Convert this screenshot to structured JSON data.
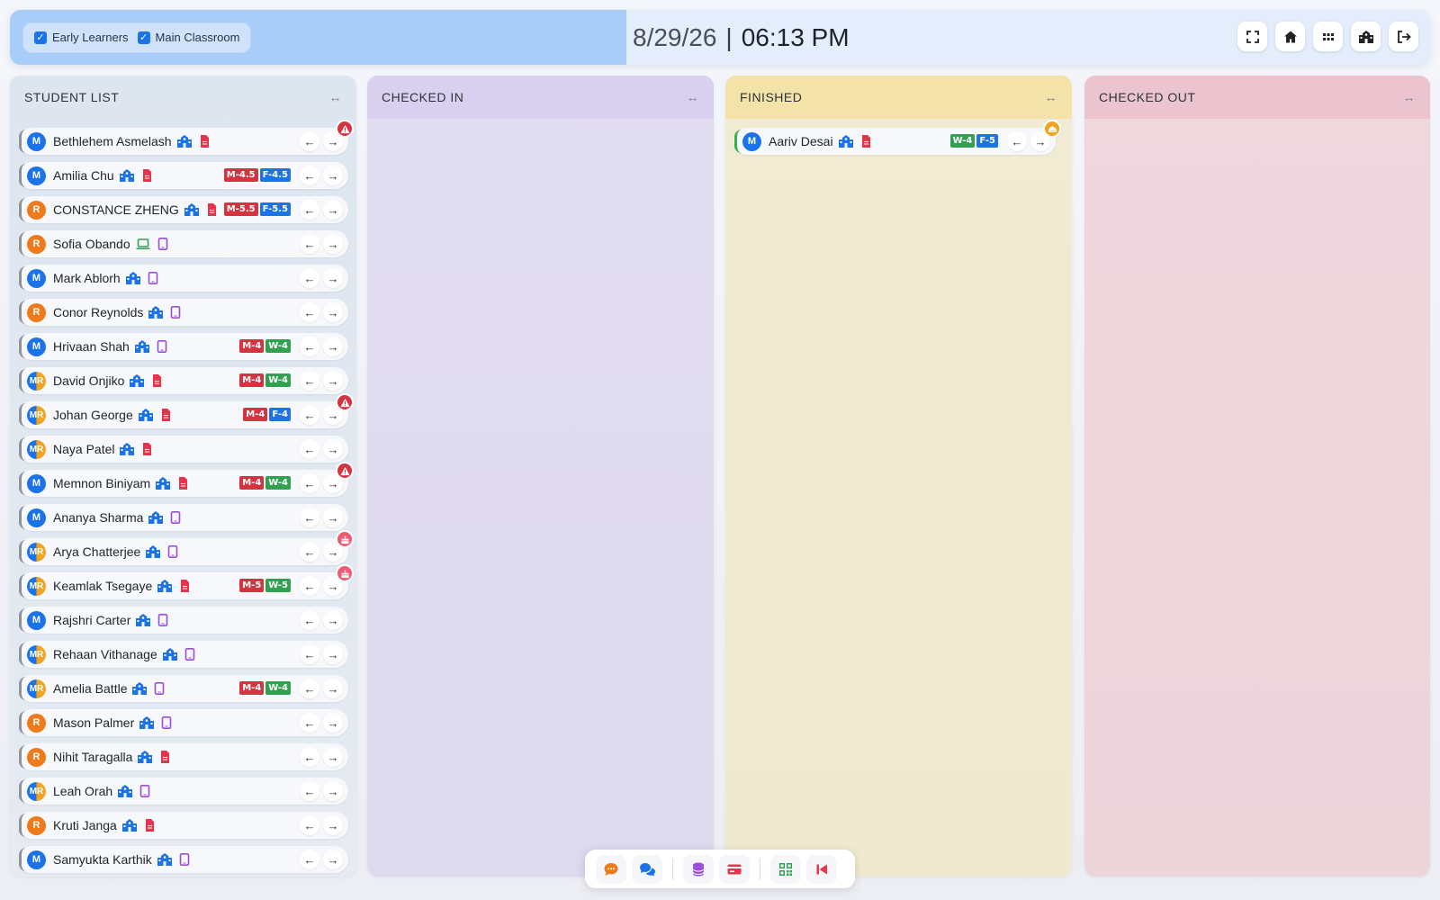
{
  "header": {
    "filters": [
      {
        "label": "Early Learners",
        "checked": true
      },
      {
        "label": "Main Classroom",
        "checked": true
      }
    ],
    "date": "8/29/26",
    "separator": "|",
    "time": "06:13 PM",
    "actions": [
      "fullscreen-icon",
      "home-icon",
      "apps-grid-icon",
      "school-icon",
      "logout-icon"
    ]
  },
  "columns": {
    "students": {
      "title": "STUDENT LIST",
      "expand": "↔"
    },
    "checked_in": {
      "title": "CHECKED IN",
      "expand": "↔"
    },
    "finished": {
      "title": "FINISHED",
      "expand": "↔"
    },
    "checked_out": {
      "title": "CHECKED OUT",
      "expand": "↔"
    }
  },
  "arrows": {
    "back": "←",
    "forward": "→"
  },
  "students": [
    {
      "avatar": "M",
      "name": "Bethlehem Asmelash",
      "icon1": "school-icon",
      "icon2": "document-icon",
      "badges": [],
      "alert": "warning"
    },
    {
      "avatar": "M",
      "name": "Amilia Chu",
      "icon1": "school-icon",
      "icon2": "document-icon",
      "badges": [
        {
          "text": "M-4.5",
          "color": "red"
        },
        {
          "text": "F-4.5",
          "color": "blue"
        }
      ],
      "alert": ""
    },
    {
      "avatar": "R",
      "name": "CONSTANCE ZHENG",
      "icon1": "school-icon",
      "icon2": "document-icon",
      "badges": [
        {
          "text": "M-5.5",
          "color": "red"
        },
        {
          "text": "F-5.5",
          "color": "blue"
        }
      ],
      "alert": ""
    },
    {
      "avatar": "R",
      "name": "Sofia Obando",
      "icon1": "laptop-icon",
      "icon2": "tablet-icon",
      "badges": [],
      "alert": ""
    },
    {
      "avatar": "M",
      "name": "Mark Ablorh",
      "icon1": "school-icon",
      "icon2": "tablet-icon",
      "badges": [],
      "alert": ""
    },
    {
      "avatar": "R",
      "name": "Conor Reynolds",
      "icon1": "school-icon",
      "icon2": "tablet-icon",
      "badges": [],
      "alert": ""
    },
    {
      "avatar": "M",
      "name": "Hrivaan Shah",
      "icon1": "school-icon",
      "icon2": "tablet-icon",
      "badges": [
        {
          "text": "M-4",
          "color": "red"
        },
        {
          "text": "W-4",
          "color": "green"
        }
      ],
      "alert": ""
    },
    {
      "avatar": "MR",
      "name": "David Onjiko",
      "icon1": "school-icon",
      "icon2": "document-icon",
      "badges": [
        {
          "text": "M-4",
          "color": "red"
        },
        {
          "text": "W-4",
          "color": "green"
        }
      ],
      "alert": ""
    },
    {
      "avatar": "MR",
      "name": "Johan George",
      "icon1": "school-icon",
      "icon2": "document-icon",
      "badges": [
        {
          "text": "M-4",
          "color": "red"
        },
        {
          "text": "F-4",
          "color": "blue"
        }
      ],
      "alert": "warning"
    },
    {
      "avatar": "MR",
      "name": "Naya Patel",
      "icon1": "school-icon",
      "icon2": "document-icon",
      "badges": [],
      "alert": ""
    },
    {
      "avatar": "M",
      "name": "Memnon Biniyam",
      "icon1": "school-icon",
      "icon2": "document-icon",
      "badges": [
        {
          "text": "M-4",
          "color": "red"
        },
        {
          "text": "W-4",
          "color": "green"
        }
      ],
      "alert": "warning"
    },
    {
      "avatar": "M",
      "name": "Ananya Sharma",
      "icon1": "school-icon",
      "icon2": "tablet-icon",
      "badges": [],
      "alert": ""
    },
    {
      "avatar": "MR",
      "name": "Arya Chatterjee",
      "icon1": "school-icon",
      "icon2": "tablet-icon",
      "badges": [],
      "alert": "birthday"
    },
    {
      "avatar": "MR",
      "name": "Keamlak Tsegaye",
      "icon1": "school-icon",
      "icon2": "document-icon",
      "badges": [
        {
          "text": "M-5",
          "color": "red"
        },
        {
          "text": "W-5",
          "color": "green"
        }
      ],
      "alert": "birthday"
    },
    {
      "avatar": "M",
      "name": "Rajshri Carter",
      "icon1": "school-icon",
      "icon2": "tablet-icon",
      "badges": [],
      "alert": ""
    },
    {
      "avatar": "MR",
      "name": "Rehaan Vithanage",
      "icon1": "school-icon",
      "icon2": "tablet-icon",
      "badges": [],
      "alert": ""
    },
    {
      "avatar": "MR",
      "name": "Amelia Battle",
      "icon1": "school-icon",
      "icon2": "tablet-icon",
      "badges": [
        {
          "text": "M-4",
          "color": "red"
        },
        {
          "text": "W-4",
          "color": "green"
        }
      ],
      "alert": ""
    },
    {
      "avatar": "R",
      "name": "Mason Palmer",
      "icon1": "school-icon",
      "icon2": "tablet-icon",
      "badges": [],
      "alert": ""
    },
    {
      "avatar": "R",
      "name": "Nihit Taragalla",
      "icon1": "school-icon",
      "icon2": "document-icon",
      "badges": [],
      "alert": ""
    },
    {
      "avatar": "MR",
      "name": "Leah Orah",
      "icon1": "school-icon",
      "icon2": "tablet-icon",
      "badges": [],
      "alert": ""
    },
    {
      "avatar": "R",
      "name": "Kruti Janga",
      "icon1": "school-icon",
      "icon2": "document-icon",
      "badges": [],
      "alert": ""
    },
    {
      "avatar": "M",
      "name": "Samyukta Karthik",
      "icon1": "school-icon",
      "icon2": "tablet-icon",
      "badges": [],
      "alert": ""
    }
  ],
  "finished": [
    {
      "avatar": "M",
      "name": "Aariv Desai",
      "icon1": "school-icon",
      "icon2": "document-icon",
      "badges": [
        {
          "text": "W-4",
          "color": "green"
        },
        {
          "text": "F-5",
          "color": "blue"
        }
      ],
      "alert": "pickup"
    }
  ],
  "toolbar": [
    "chat-bubble-icon",
    "conversations-icon",
    "database-icon",
    "card-icon",
    "qr-code-icon",
    "skip-back-icon"
  ],
  "colors": {
    "header_left": "#a9cdf9",
    "header_right": "#e3edfb",
    "primary_blue": "#1a73e8",
    "avatar_orange": "#f07a1a",
    "badge_red": "#d63340",
    "badge_green": "#30a14e",
    "checked_in_bg": "#ddd9ef",
    "finished_bg": "#efe9cf",
    "checked_out_bg": "#ecd4db"
  }
}
